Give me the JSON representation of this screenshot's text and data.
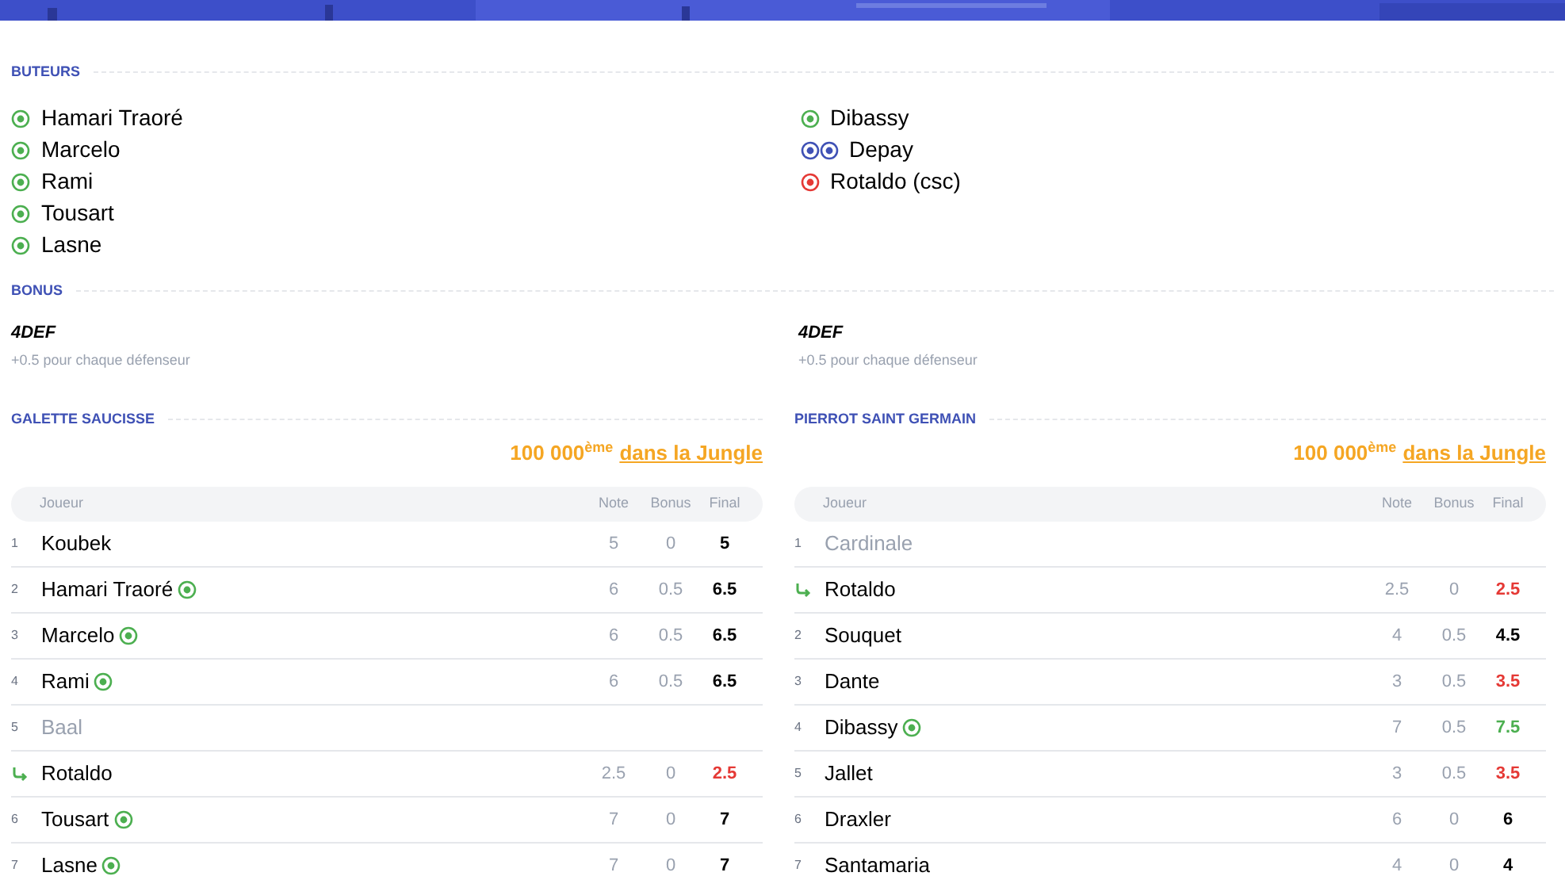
{
  "scorers": {
    "title": "BUTEURS",
    "home": [
      {
        "name": "Hamari Traoré",
        "kind": "goal"
      },
      {
        "name": "Marcelo",
        "kind": "goal"
      },
      {
        "name": "Rami",
        "kind": "goal"
      },
      {
        "name": "Tousart",
        "kind": "goal"
      },
      {
        "name": "Lasne",
        "kind": "goal"
      }
    ],
    "away": [
      {
        "name": "Dibassy",
        "kind": "goal"
      },
      {
        "name": "Depay",
        "kind": "double"
      },
      {
        "name": "Rotaldo (csc)",
        "kind": "own_goal"
      }
    ]
  },
  "bonus": {
    "title": "BONUS",
    "items": [
      {
        "name": "4DEF",
        "description": "+0.5 pour chaque défenseur"
      },
      {
        "name": "4DEF",
        "description": "+0.5 pour chaque défenseur"
      }
    ]
  },
  "teams": [
    {
      "name": "GALETTE SAUCISSE",
      "formation": "100 000$^{ème}$",
      "link": "dans la Jungle",
      "columns": [
        "Joueur",
        "Note",
        "Bonus",
        "Final"
      ],
      "rows": [
        {
          "kind": "starter",
          "number": "1",
          "name": "Koubek",
          "scored": false,
          "absent": false,
          "note": "5",
          "bonus": "0",
          "final": "5",
          "color": "#000000"
        },
        {
          "kind": "starter",
          "number": "2",
          "name": "Hamari Traoré",
          "scored": true,
          "absent": false,
          "note": "6",
          "bonus": "0.5",
          "final": "6.5",
          "color": "#000000"
        },
        {
          "kind": "starter",
          "number": "3",
          "name": "Marcelo",
          "scored": true,
          "absent": false,
          "note": "6",
          "bonus": "0.5",
          "final": "6.5",
          "color": "#000000"
        },
        {
          "kind": "starter",
          "number": "4",
          "name": "Rami",
          "scored": true,
          "absent": false,
          "note": "6",
          "bonus": "0.5",
          "final": "6.5",
          "color": "#000000"
        },
        {
          "kind": "starter",
          "number": "5",
          "name": "Baal",
          "scored": false,
          "absent": true
        },
        {
          "kind": "sub",
          "name": "Rotaldo",
          "scored": false,
          "absent": false,
          "note": "2.5",
          "bonus": "0",
          "final": "2.5",
          "color": "#e53935"
        },
        {
          "kind": "starter",
          "number": "6",
          "name": "Tousart",
          "scored": true,
          "absent": false,
          "note": "7",
          "bonus": "0",
          "final": "7",
          "color": "#000000"
        },
        {
          "kind": "starter",
          "number": "7",
          "name": "Lasne",
          "scored": true,
          "absent": false,
          "note": "7",
          "bonus": "0",
          "final": "7",
          "color": "#000000"
        }
      ]
    },
    {
      "name": "PIERROT SAINT GERMAIN",
      "formation": "100 000$^{ème}$",
      "link": "dans la Jungle",
      "columns": [
        "Joueur",
        "Note",
        "Bonus",
        "Final"
      ],
      "rows": [
        {
          "kind": "starter",
          "number": "1",
          "name": "Cardinale",
          "scored": false,
          "absent": true
        },
        {
          "kind": "sub",
          "name": "Rotaldo",
          "scored": false,
          "absent": false,
          "note": "2.5",
          "bonus": "0",
          "final": "2.5",
          "color": "#e53935"
        },
        {
          "kind": "starter",
          "number": "2",
          "name": "Souquet",
          "scored": false,
          "absent": false,
          "note": "4",
          "bonus": "0.5",
          "final": "4.5",
          "color": "#000000"
        },
        {
          "kind": "starter",
          "number": "3",
          "name": "Dante",
          "scored": false,
          "absent": false,
          "note": "3",
          "bonus": "0.5",
          "final": "3.5",
          "color": "#e53935"
        },
        {
          "kind": "starter",
          "number": "4",
          "name": "Dibassy",
          "scored": true,
          "absent": false,
          "note": "7",
          "bonus": "0.5",
          "final": "7.5",
          "color": "#4caf50"
        },
        {
          "kind": "starter",
          "number": "5",
          "name": "Jallet",
          "scored": false,
          "absent": false,
          "note": "3",
          "bonus": "0.5",
          "final": "3.5",
          "color": "#e53935"
        },
        {
          "kind": "starter",
          "number": "6",
          "name": "Draxler",
          "scored": false,
          "absent": false,
          "note": "6",
          "bonus": "0",
          "final": "6",
          "color": "#000000"
        },
        {
          "kind": "starter",
          "number": "7",
          "name": "Santamaria",
          "scored": false,
          "absent": false,
          "note": "4",
          "bonus": "0",
          "final": "4",
          "color": "#000000"
        }
      ]
    }
  ]
}
